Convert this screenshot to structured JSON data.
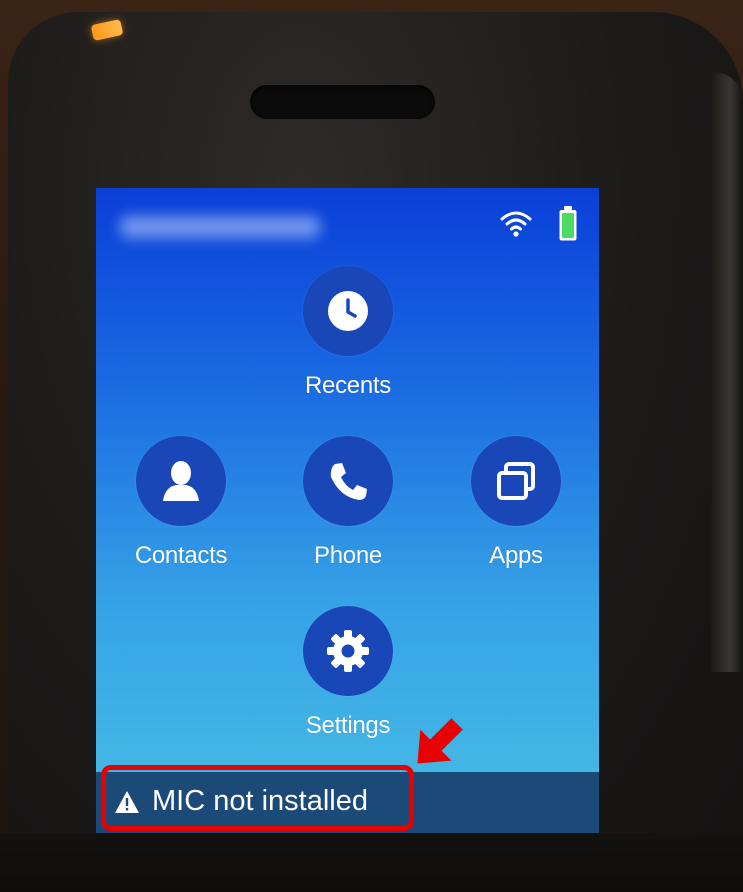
{
  "status_bar": {
    "device_name": "",
    "wifi_icon": "wifi-icon",
    "battery_icon": "battery-icon"
  },
  "apps": [
    {
      "label": "Recents",
      "icon": "clock-icon"
    },
    {
      "label": "Contacts",
      "icon": "person-icon"
    },
    {
      "label": "Phone",
      "icon": "phone-handset-icon"
    },
    {
      "label": "Apps",
      "icon": "stacked-windows-icon"
    },
    {
      "label": "Settings",
      "icon": "gear-icon"
    }
  ],
  "notification": {
    "icon": "warning-triangle-icon",
    "text": "MIC not installed"
  },
  "colors": {
    "accent": "#1947b8",
    "annotation": "#e60000",
    "battery": "#4cd964",
    "notification_bar": "#1b4a79"
  }
}
